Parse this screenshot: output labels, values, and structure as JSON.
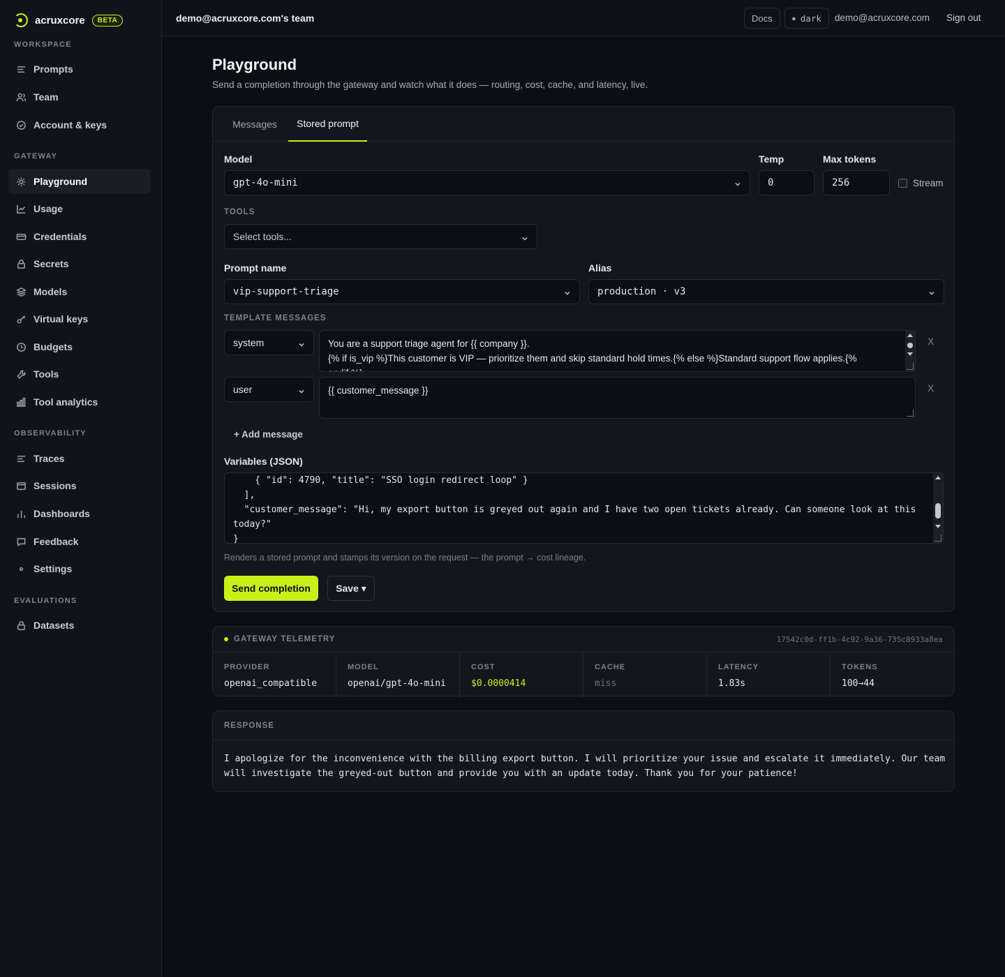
{
  "brand": {
    "name": "acruxcore",
    "badge": "BETA"
  },
  "sidebar": {
    "sections": [
      {
        "title": "WORKSPACE",
        "items": [
          {
            "label": "Prompts",
            "icon": "lines-icon"
          },
          {
            "label": "Team",
            "icon": "users-icon"
          },
          {
            "label": "Account & keys",
            "icon": "check-circle-icon"
          }
        ]
      },
      {
        "title": "GATEWAY",
        "items": [
          {
            "label": "Playground",
            "icon": "sun-icon",
            "active": true
          },
          {
            "label": "Usage",
            "icon": "chart-line-icon"
          },
          {
            "label": "Credentials",
            "icon": "card-icon"
          },
          {
            "label": "Secrets",
            "icon": "lock-icon"
          },
          {
            "label": "Models",
            "icon": "layers-icon"
          },
          {
            "label": "Virtual keys",
            "icon": "key-icon"
          },
          {
            "label": "Budgets",
            "icon": "clock-icon"
          },
          {
            "label": "Tools",
            "icon": "wrench-icon"
          },
          {
            "label": "Tool analytics",
            "icon": "bar-chart-icon"
          }
        ]
      },
      {
        "title": "OBSERVABILITY",
        "items": [
          {
            "label": "Traces",
            "icon": "traces-icon"
          },
          {
            "label": "Sessions",
            "icon": "window-icon"
          },
          {
            "label": "Dashboards",
            "icon": "bars-icon"
          },
          {
            "label": "Feedback",
            "icon": "comment-icon"
          },
          {
            "label": "Settings",
            "icon": "dot-icon"
          }
        ]
      },
      {
        "title": "EVALUATIONS",
        "items": [
          {
            "label": "Datasets",
            "icon": "lock-icon"
          }
        ]
      }
    ]
  },
  "topbar": {
    "team": "demo@acruxcore.com's team",
    "docs": "Docs",
    "theme": "dark",
    "email": "demo@acruxcore.com",
    "signout": "Sign out"
  },
  "page": {
    "title": "Playground",
    "subtitle": "Send a completion through the gateway and watch what it does — routing, cost, cache, and latency, live."
  },
  "form": {
    "tabs": [
      "Messages",
      "Stored prompt"
    ],
    "active_tab": "Stored prompt",
    "model_label": "Model",
    "model_value": "gpt-4o-mini",
    "temp_label": "Temp",
    "temp_value": "0",
    "max_tokens_label": "Max tokens",
    "max_tokens_value": "256",
    "stream_label": "Stream",
    "tools_label": "TOOLS",
    "tools_placeholder": "Select tools...",
    "prompt_name_label": "Prompt name",
    "prompt_name_value": "vip-support-triage",
    "alias_label": "Alias",
    "alias_value": "production · v3",
    "template_label": "TEMPLATE MESSAGES",
    "messages": [
      {
        "role": "system",
        "lines": [
          "You are a support triage agent for {{ company }}.",
          "{% if is_vip %}This customer is VIP — prioritize them and skip standard hold times.{% else %}Standard support flow applies.{%",
          "endif %}"
        ]
      },
      {
        "role": "user",
        "lines": [
          "{{ customer_message }}"
        ]
      }
    ],
    "remove_label": "X",
    "add_message": "+ Add message",
    "variables_label": "Variables (JSON)",
    "variables_lines": [
      "    { \"id\": 4790, \"title\": \"SSO login redirect loop\" }",
      "  ],",
      "  \"customer_message\": \"Hi, my export button is greyed out again and I have two open tickets already. Can someone look at this",
      "today?\"",
      "}"
    ],
    "hint": "Renders a stored prompt and stamps its version on the request — the prompt → cost lineage.",
    "send_button": "Send completion",
    "save_button": "Save ▾"
  },
  "telemetry": {
    "title": "GATEWAY TELEMETRY",
    "request_id": "17542c0d-ff1b-4c92-9a36-735c8933a8ea",
    "cells": [
      {
        "label": "PROVIDER",
        "value": "openai_compatible"
      },
      {
        "label": "MODEL",
        "value": "openai/gpt-4o-mini"
      },
      {
        "label": "COST",
        "value": "$0.0000414"
      },
      {
        "label": "CACHE",
        "value": "miss"
      },
      {
        "label": "LATENCY",
        "value": "1.83s"
      },
      {
        "label": "TOKENS",
        "value": "100→44"
      }
    ]
  },
  "response": {
    "title": "RESPONSE",
    "lines": [
      "I apologize for the inconvenience with the billing export button. I will prioritize your issue and escalate it immediately. Our team",
      "will investigate the greyed-out button and provide you with an update today. Thank you for your patience!"
    ]
  },
  "colors": {
    "accent": "#c6f21a",
    "background": "#0b0e13",
    "panel": "#12161d"
  }
}
